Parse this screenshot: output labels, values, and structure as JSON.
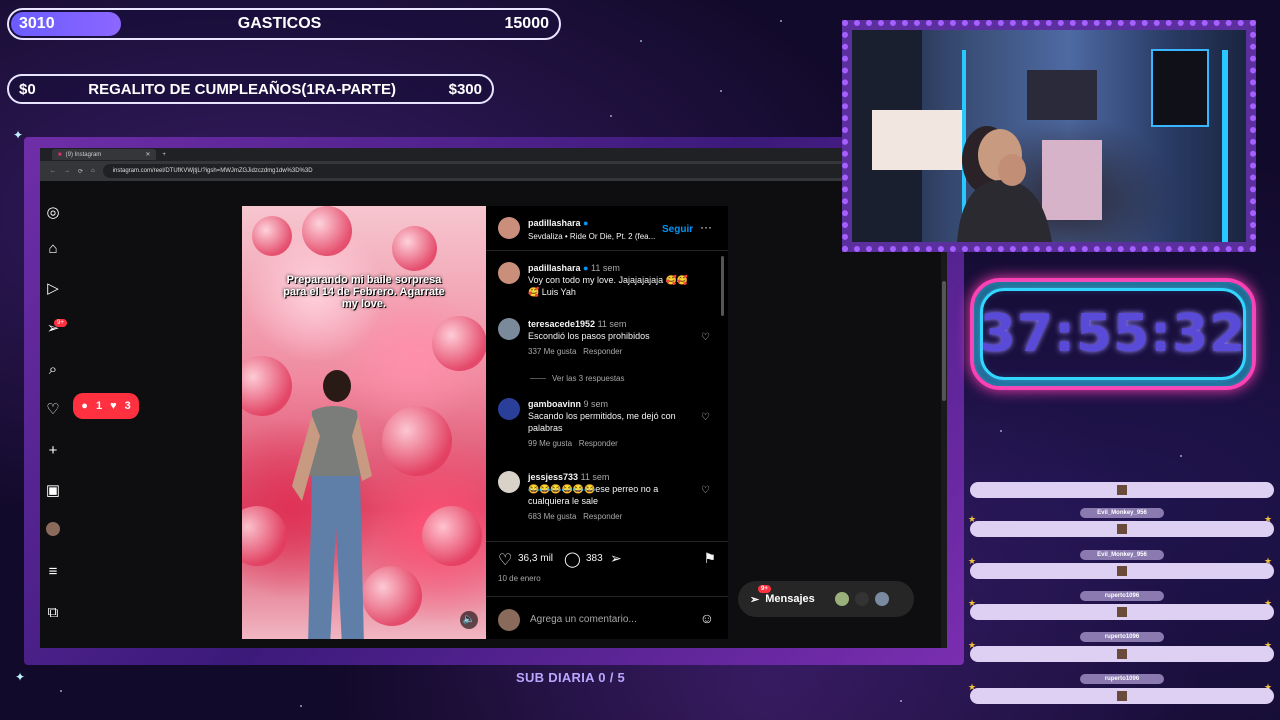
{
  "goal_bar": {
    "current": "3010",
    "title": "GASTICOS",
    "target": "15000",
    "progress": 0.2
  },
  "gift_goal": {
    "current": "$0",
    "title": "REGALITO DE CUMPLEAÑOS(1RA-PARTE)",
    "target": "$300"
  },
  "browser": {
    "tab_title": "(9) Instagram",
    "url": "instagram.com/reel/DTUfKVWjtjL/?igsh=MWJmZGJidzczdmg1dw%3D%3D"
  },
  "reel": {
    "caption": "Preparando mi baile sorpresa para el 14 de Febrero. Agarrate my love.",
    "author": "padillashara",
    "audio": "Sevdaliza • Ride Or Die, Pt. 2 (fea...",
    "follow_label": "Seguir",
    "likes": "36,3 mil",
    "comments_count": "383",
    "date": "10 de enero",
    "add_comment_placeholder": "Agrega un comentario..."
  },
  "comments": [
    {
      "user": "padillashara",
      "time": "11 sem",
      "text": "Voy con todo my love. Jajajajajaja 🥰🥰🥰 Luis Yah",
      "likes": "",
      "reply": ""
    },
    {
      "user": "teresacede1952",
      "time": "11 sem",
      "text": "Escondió los pasos prohibidos",
      "likes": "337 Me gusta",
      "reply": "Responder"
    },
    {
      "user": "gamboavinn",
      "time": "9 sem",
      "text": "Sacando los permitidos, me dejó con palabras",
      "likes": "99 Me gusta",
      "reply": "Responder"
    },
    {
      "user": "jessjess733",
      "time": "11 sem",
      "text": "😂😂😂😂😂😂ese perreo no a cualquiera le sale",
      "likes": "683 Me gusta",
      "reply": "Responder"
    }
  ],
  "view_replies": "Ver las 3 respuestas",
  "messages_label": "Mensajes",
  "messages_badge": "9+",
  "nav_badge": "9+",
  "likes_popup": {
    "comments": "1",
    "likes": "3"
  },
  "timer": "37:55:32",
  "events": [
    {
      "name": ""
    },
    {
      "name": "Evil_Monkey_956"
    },
    {
      "name": "Evil_Monkey_956"
    },
    {
      "name": "ruperto1096"
    },
    {
      "name": "ruperto1096"
    },
    {
      "name": "ruperto1096"
    }
  ],
  "sub_goal": "SUB DIARIA 0 / 5"
}
